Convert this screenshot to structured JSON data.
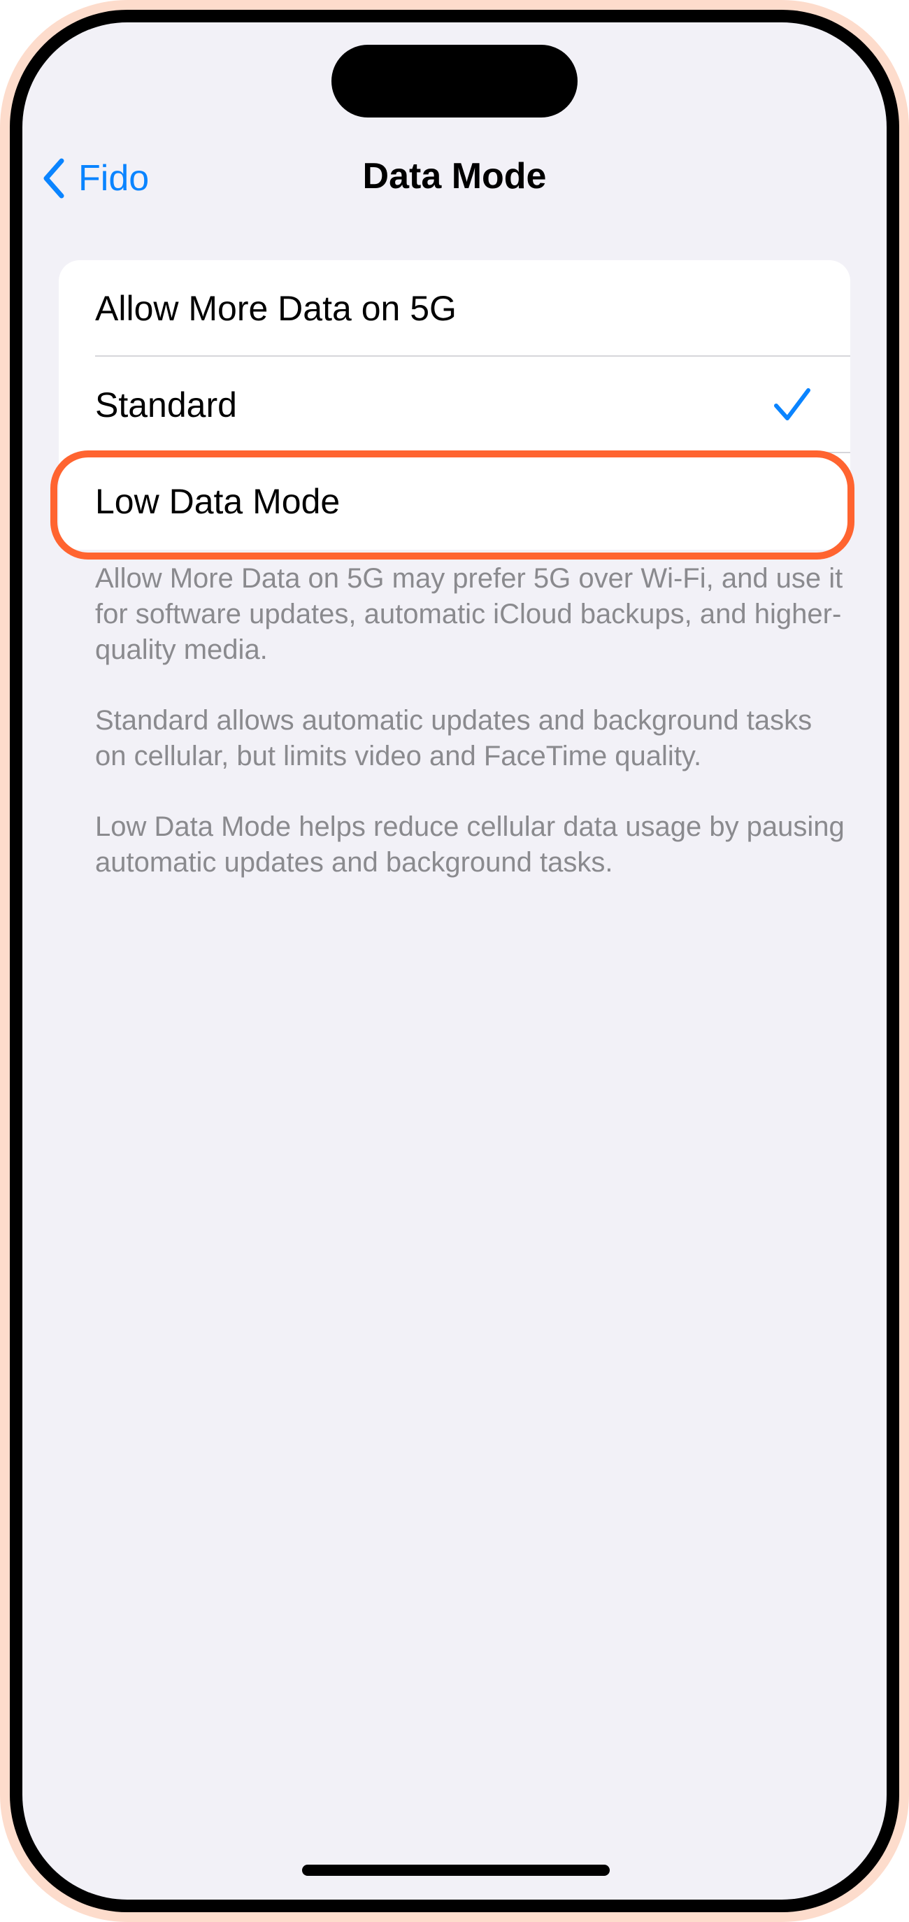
{
  "nav": {
    "back_label": "Fido",
    "title": "Data Mode"
  },
  "options": [
    {
      "label": "Allow More Data on 5G",
      "selected": false
    },
    {
      "label": "Standard",
      "selected": true
    },
    {
      "label": "Low Data Mode",
      "selected": false,
      "highlighted": true
    }
  ],
  "footer": {
    "paragraphs": [
      "Allow More Data on 5G may prefer 5G over Wi-Fi, and use it for software updates, automatic iCloud backups, and higher-quality media.",
      "Standard allows automatic updates and background tasks on cellular, but limits video and FaceTime quality.",
      "Low Data Mode helps reduce cellular data usage by pausing automatic updates and background tasks."
    ]
  },
  "colors": {
    "accent": "#0a84ff",
    "highlight": "#ff6430",
    "background": "#f2f1f7"
  },
  "icons": {
    "back": "chevron-left-icon",
    "selected": "checkmark-icon"
  }
}
